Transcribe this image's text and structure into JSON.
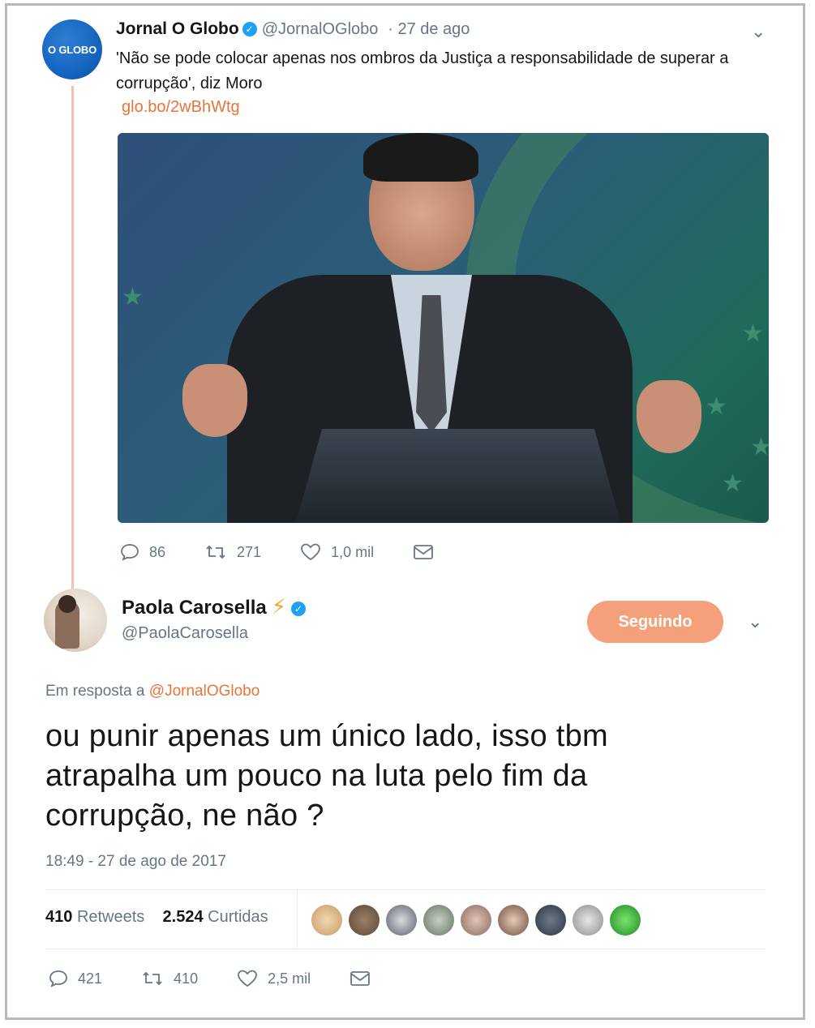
{
  "parent_tweet": {
    "avatar_text": "O GLOBO",
    "name": "Jornal O Globo",
    "handle": "@JornalOGlobo",
    "date": "· 27 de ago",
    "text": "'Não se pode colocar apenas nos ombros da Justiça a responsabilidade de superar a corrupção', diz Moro",
    "link": "glo.bo/2wBhWtg",
    "replies": "86",
    "retweets": "271",
    "likes": "1,0 mil"
  },
  "main_tweet": {
    "name": "Paola Carosella",
    "handle": "@PaolaCarosella",
    "follow_label": "Seguindo",
    "reply_prefix": "Em resposta a",
    "reply_to": "@JornalOGlobo",
    "text": "ou punir apenas um único lado, isso tbm atrapalha um pouco na luta pelo fim da corrupção, ne não ?",
    "timestamp": "18:49 - 27 de ago de 2017",
    "retweet_count": "410",
    "retweet_label": "Retweets",
    "like_count": "2.524",
    "like_label": "Curtidas",
    "replies": "421",
    "retweets": "410",
    "likes": "2,5 mil"
  },
  "colors": {
    "accent": "#e8733b",
    "follow_button": "#f4a07a",
    "verified": "#1da1f2",
    "thread_line": "#f4c2a8"
  },
  "icons": [
    "reply-icon",
    "retweet-icon",
    "like-icon",
    "message-icon",
    "chevron-down-icon",
    "verified-icon",
    "lightning-icon"
  ]
}
